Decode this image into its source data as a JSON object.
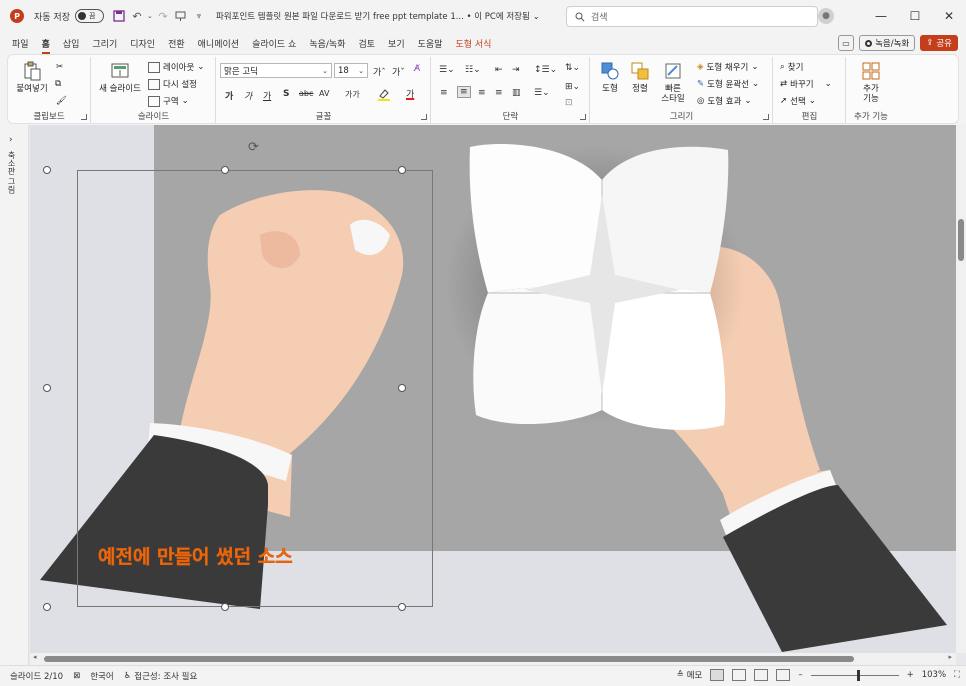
{
  "titlebar": {
    "app_icon": "P",
    "autosave_label": "자동 저장",
    "autosave_state": "끔",
    "doc_title": "파워포인트 템플릿 원본 파일 다운로드 받기 free ppt template 1... • 이 PC에 저장됨",
    "search_placeholder": "검색",
    "icons": [
      "save-icon",
      "undo-icon",
      "redo-icon",
      "present-icon",
      "customize-icon"
    ]
  },
  "tabs": [
    {
      "label": "파일"
    },
    {
      "label": "홈",
      "active": true
    },
    {
      "label": "삽입"
    },
    {
      "label": "그리기"
    },
    {
      "label": "디자인"
    },
    {
      "label": "전환"
    },
    {
      "label": "애니메이션"
    },
    {
      "label": "슬라이드 쇼"
    },
    {
      "label": "녹음/녹화"
    },
    {
      "label": "검토"
    },
    {
      "label": "보기"
    },
    {
      "label": "도움말"
    },
    {
      "label": "도형 서식",
      "context": true
    }
  ],
  "tab_actions": {
    "record": "녹음/녹화",
    "share": "공유"
  },
  "ribbon": {
    "clipboard": {
      "paste": "붙여넣기",
      "label": "클립보드"
    },
    "slides": {
      "new_slide": "새 슬라이드",
      "layout": "레이아웃",
      "reset": "다시 설정",
      "section": "구역",
      "label": "슬라이드"
    },
    "font": {
      "font_name": "맑은 고딕",
      "font_size": "18",
      "label": "글꼴",
      "buttons": [
        "가",
        "가",
        "가",
        "S",
        "abc",
        "AV",
        "가가",
        "가"
      ]
    },
    "paragraph": {
      "label": "단락"
    },
    "drawing": {
      "shape": "도형",
      "arrange": "정렬",
      "quick_style_1": "빠른",
      "quick_style_2": "스타일",
      "fill": "도형 채우기",
      "outline": "도형 윤곽선",
      "effect": "도형 효과",
      "label": "그리기"
    },
    "editing": {
      "find": "찾기",
      "replace": "바꾸기",
      "select": "선택",
      "label": "편집"
    },
    "addins": {
      "label_1": "추가",
      "label_2": "기능",
      "label": "추가 기능"
    }
  },
  "rail": {
    "label": "축소판 그림"
  },
  "slide": {
    "caption": "예전에 만들어 썼던 소스"
  },
  "statusbar": {
    "slide_info": "슬라이드 2/10",
    "language": "한국어",
    "accessibility": "접근성: 조사 필요",
    "notes": "메모",
    "zoom": "103%",
    "zoom_minus": "–",
    "zoom_plus": "+"
  },
  "colors": {
    "accent": "#c43e1c",
    "slide_bg": "#a6a6a6",
    "sleeve": "#3a3a3a",
    "skin": "#f5cdb3",
    "caption": "#f47c20"
  }
}
